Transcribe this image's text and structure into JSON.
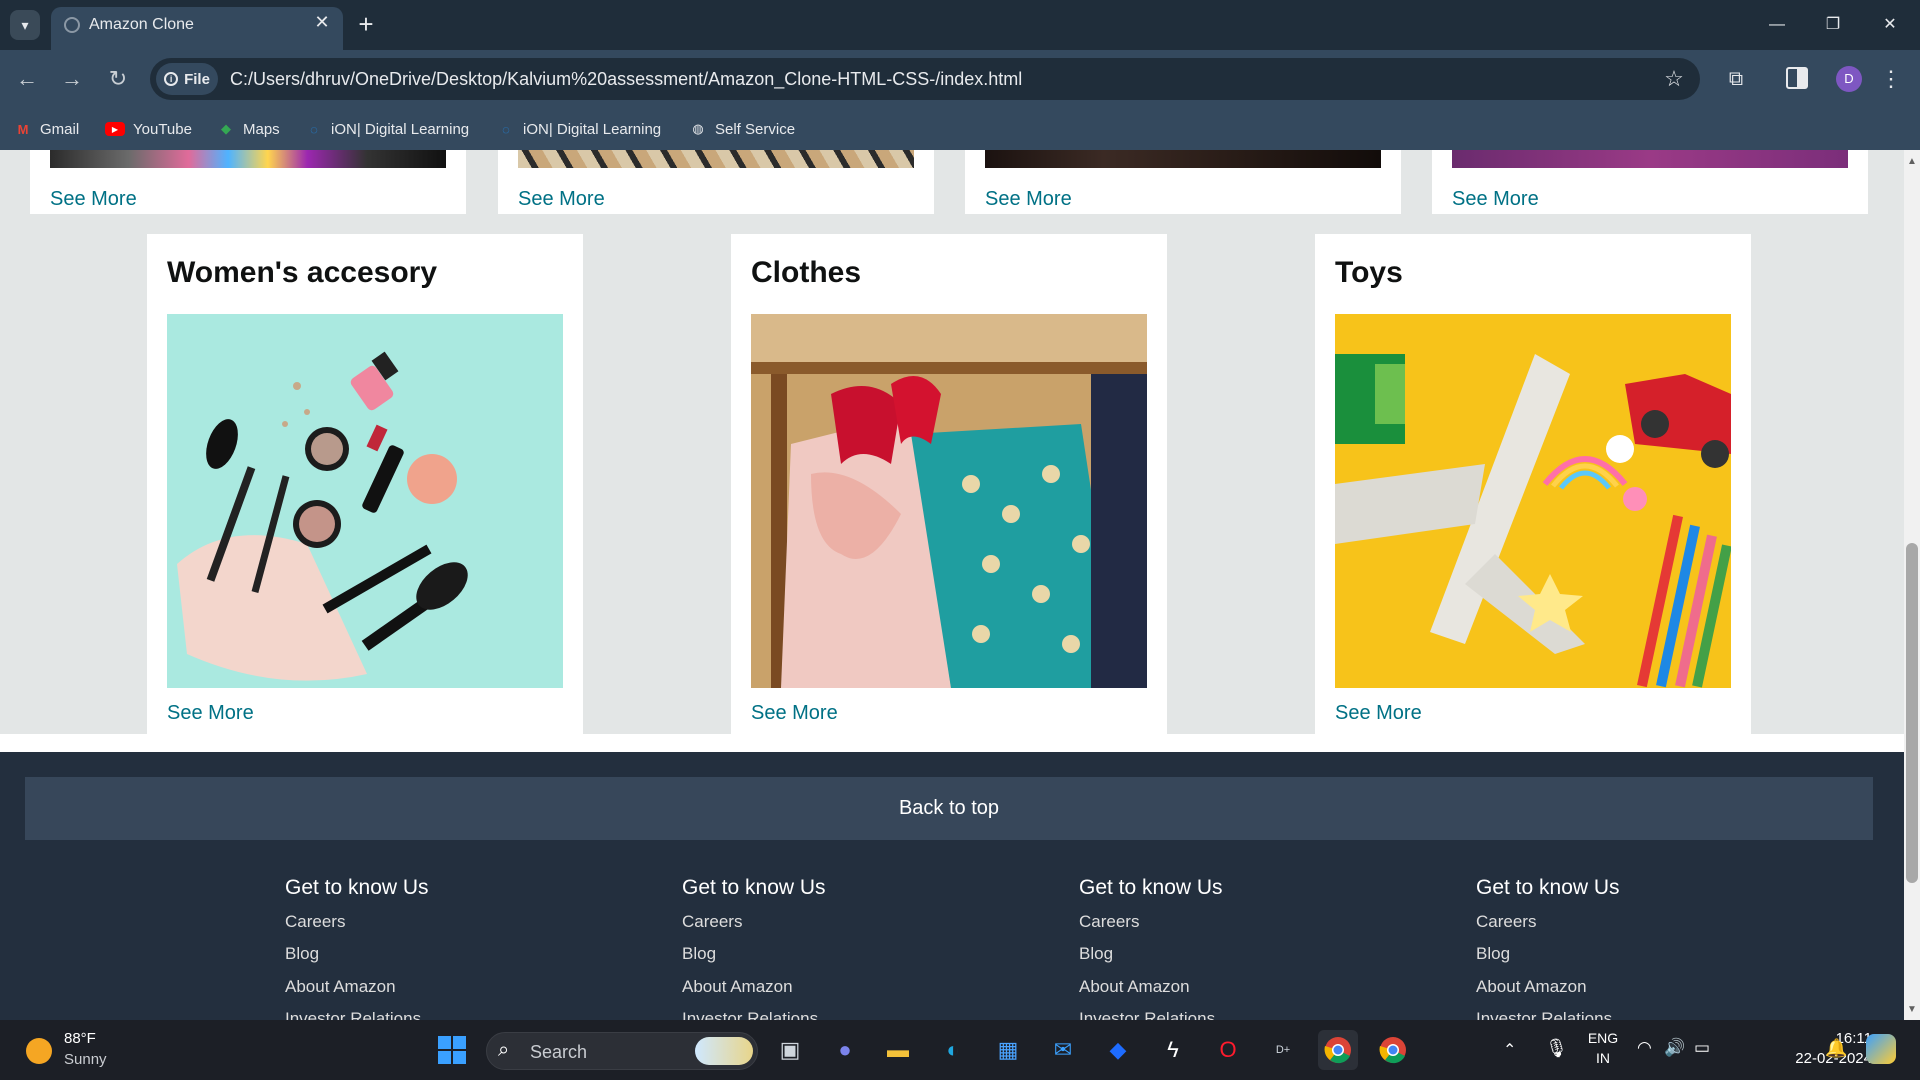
{
  "browser": {
    "tab_title": "Amazon Clone",
    "url": "C:/Users/dhruv/OneDrive/Desktop/Kalvium%20assessment/Amazon_Clone-HTML-CSS-/index.html",
    "file_chip": "File",
    "profile_initial": "D",
    "bookmarks": [
      {
        "label": "Gmail",
        "icon": "gmail-icon"
      },
      {
        "label": "YouTube",
        "icon": "youtube-icon"
      },
      {
        "label": "Maps",
        "icon": "maps-icon"
      },
      {
        "label": "iON| Digital Learning",
        "icon": "ion-icon"
      },
      {
        "label": "iON| Digital Learning",
        "icon": "ion-icon"
      },
      {
        "label": "Self Service",
        "icon": "globe-icon"
      }
    ]
  },
  "page": {
    "top_row_see_more": [
      "See More",
      "See More",
      "See More",
      "See More"
    ],
    "cards": [
      {
        "title": "Women's accesory",
        "see_more": "See More",
        "image": "makeup-flatlay"
      },
      {
        "title": "Clothes",
        "see_more": "See More",
        "image": "clothes-rack"
      },
      {
        "title": "Toys",
        "see_more": "See More",
        "image": "toys-flatlay"
      }
    ],
    "back_to_top": "Back to top",
    "footer_columns": [
      {
        "heading": "Get to know Us",
        "links": [
          "Careers",
          "Blog",
          "About Amazon",
          "Investor Relations"
        ]
      },
      {
        "heading": "Get to know Us",
        "links": [
          "Careers",
          "Blog",
          "About Amazon",
          "Investor Relations"
        ]
      },
      {
        "heading": "Get to know Us",
        "links": [
          "Careers",
          "Blog",
          "About Amazon",
          "Investor Relations"
        ]
      },
      {
        "heading": "Get to know Us",
        "links": [
          "Careers",
          "Blog",
          "About Amazon",
          "Investor Relations"
        ]
      }
    ]
  },
  "taskbar": {
    "weather_temp": "88°F",
    "weather_desc": "Sunny",
    "search_placeholder": "Search",
    "lang_line1": "ENG",
    "lang_line2": "IN",
    "time": "16:11",
    "date": "22-02-2024"
  },
  "colors": {
    "link": "#007185",
    "footer_bg": "#232f3e",
    "back_top_bg": "#37475a",
    "page_bg": "#e3e6e6"
  }
}
